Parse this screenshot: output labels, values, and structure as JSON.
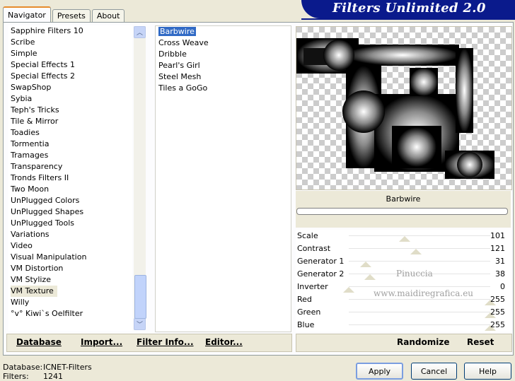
{
  "tabs": {
    "navigator": "Navigator",
    "presets": "Presets",
    "about": "About"
  },
  "app_title": "Filters Unlimited 2.0",
  "categories": [
    "Sapphire Filters 10",
    "Scribe",
    "Simple",
    "Special Effects 1",
    "Special Effects 2",
    "SwapShop",
    "Sybia",
    "Teph's Tricks",
    "Tile & Mirror",
    "Toadies",
    "Tormentia",
    "Tramages",
    "Transparency",
    "Tronds Filters II",
    "Two Moon",
    "UnPlugged Colors",
    "UnPlugged Shapes",
    "UnPlugged Tools",
    "Variations",
    "Video",
    "Visual Manipulation",
    "VM Distortion",
    "VM Stylize",
    "VM Texture",
    "Willy",
    "°v° Kiwi`s Oelfilter"
  ],
  "selected_category": "VM Texture",
  "filters": [
    "Barbwire",
    "Cross Weave",
    "Dribble",
    "Pearl's Girl",
    "Steel Mesh",
    "Tiles a GoGo"
  ],
  "selected_filter": "Barbwire",
  "toolbar": {
    "database": "Database",
    "import": "Import...",
    "filter_info": "Filter Info...",
    "editor": "Editor...",
    "randomize": "Randomize",
    "reset": "Reset"
  },
  "filter_label": "Barbwire",
  "params": [
    {
      "name": "Scale",
      "value": "101",
      "level": 101
    },
    {
      "name": "Contrast",
      "value": "121",
      "level": 121
    },
    {
      "name": "Generator 1",
      "value": "31",
      "level": 31
    },
    {
      "name": "Generator 2",
      "value": "38",
      "level": 38
    },
    {
      "name": "Inverter",
      "value": "0",
      "level": 0
    },
    {
      "name": "Red",
      "value": "255",
      "level": 255
    },
    {
      "name": "Green",
      "value": "255",
      "level": 255
    },
    {
      "name": "Blue",
      "value": "255",
      "level": 255
    }
  ],
  "watermark": {
    "line1": "Pinuccia",
    "line2": "www.maidiregrafica.eu"
  },
  "status": {
    "database_label": "Database:",
    "database_value": "ICNET-Filters",
    "filters_label": "Filters:",
    "filters_value": "1241"
  },
  "buttons": {
    "apply": "Apply",
    "cancel": "Cancel",
    "help": "Help"
  }
}
